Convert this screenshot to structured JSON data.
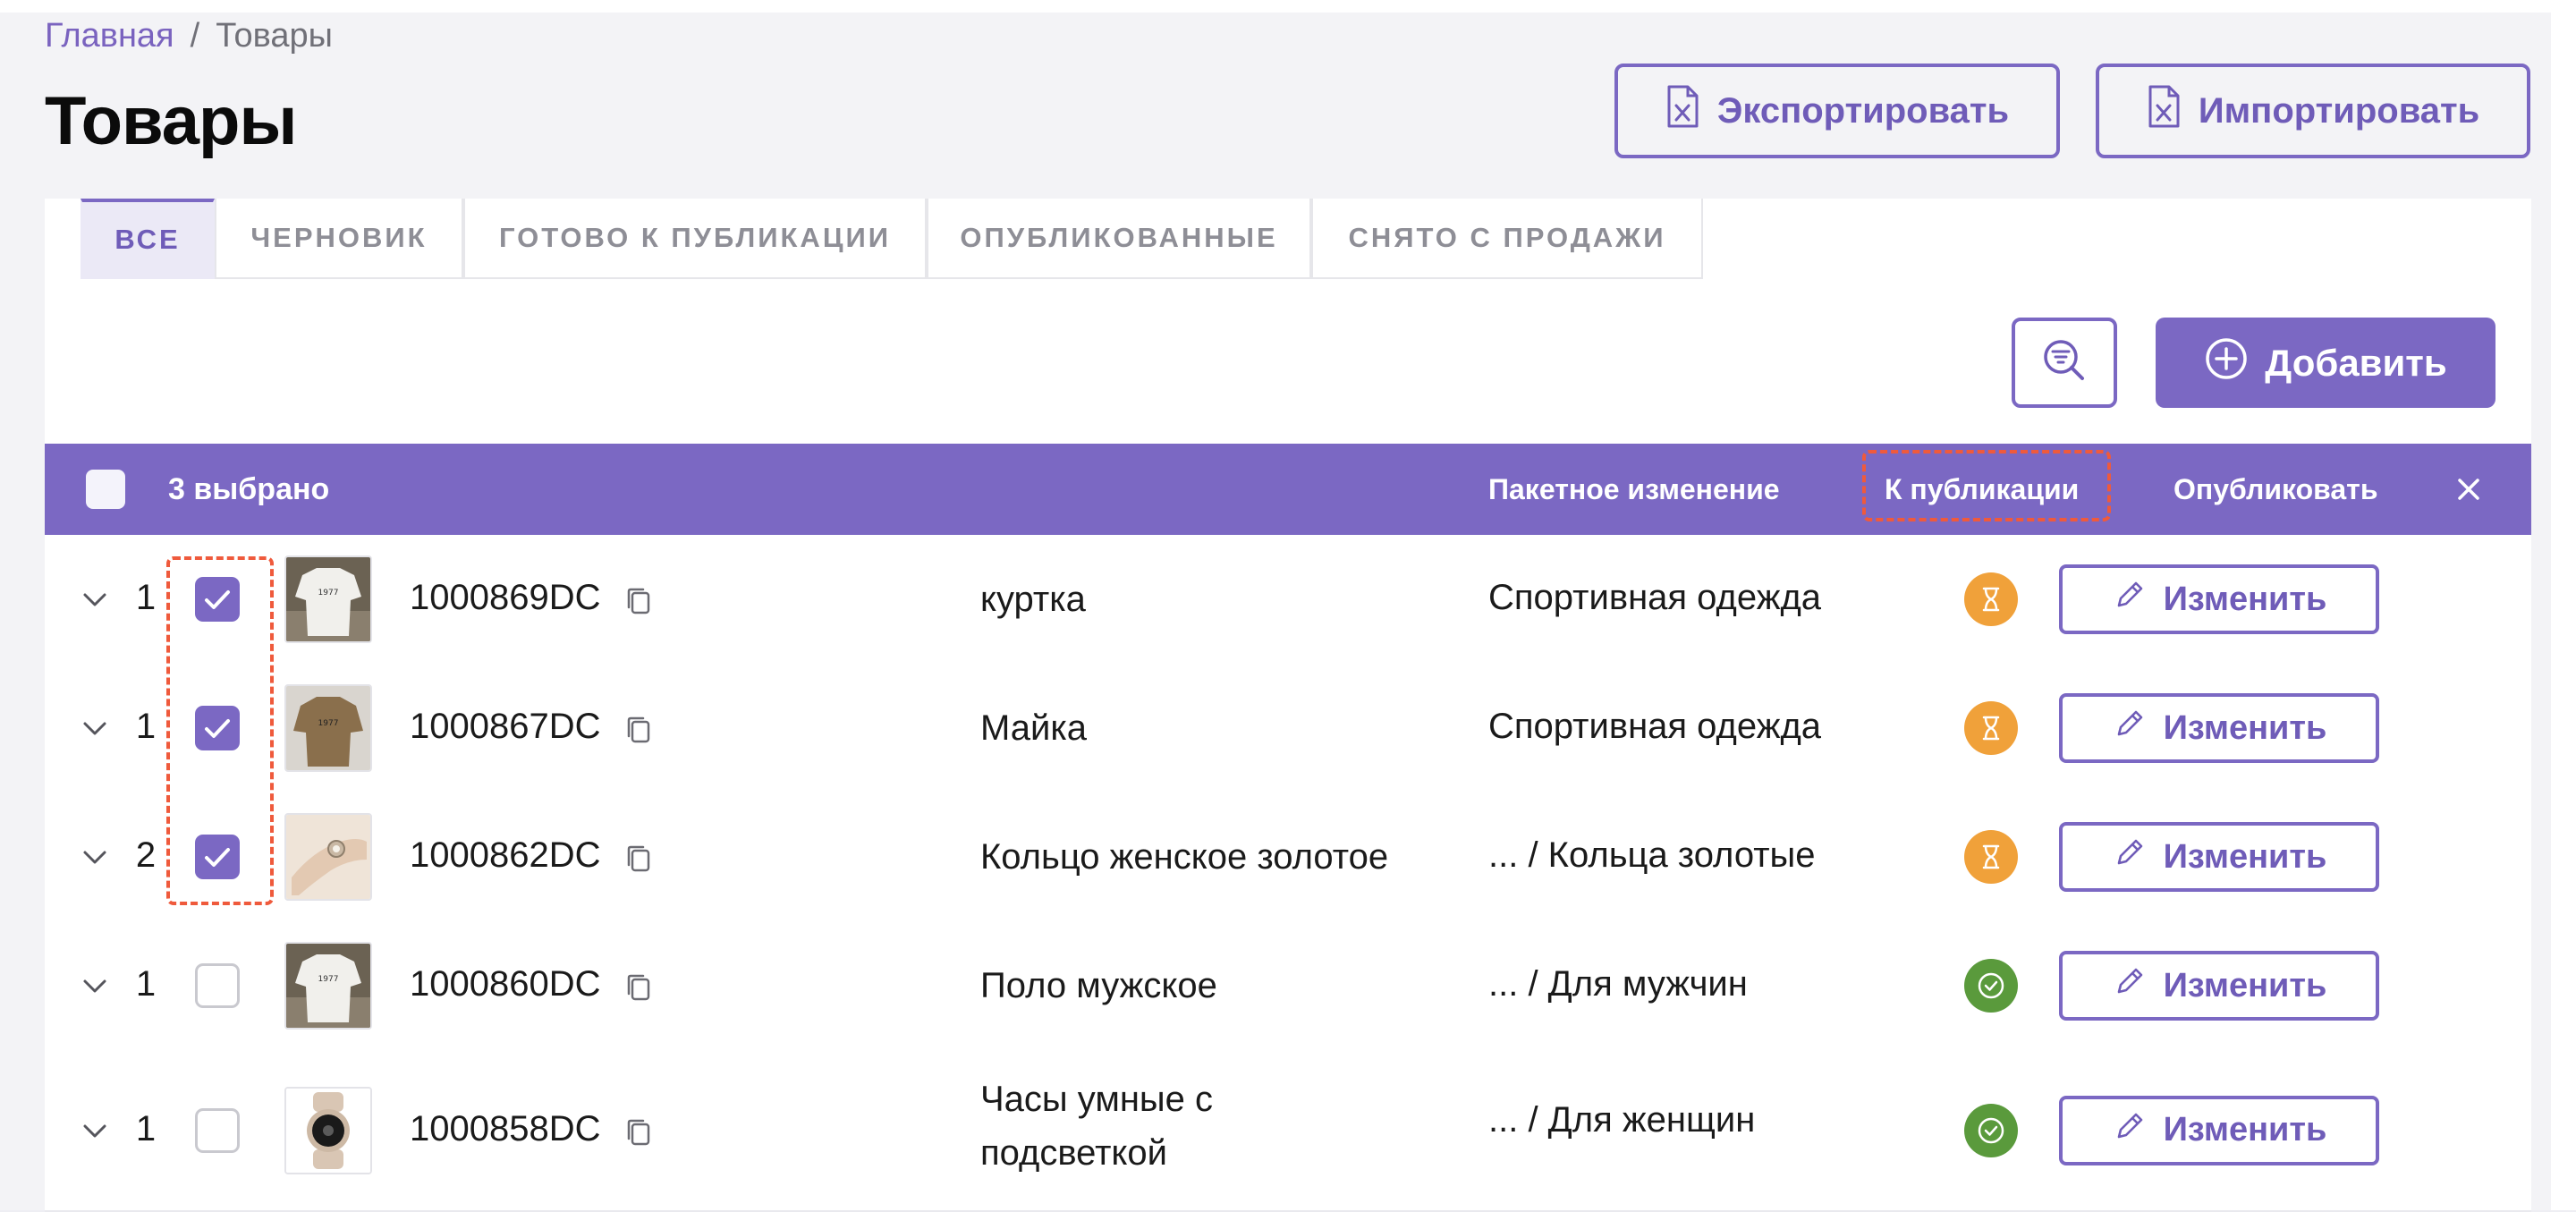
{
  "breadcrumb": {
    "home": "Главная",
    "separator": "/",
    "current": "Товары"
  },
  "page_title": "Товары",
  "header_actions": {
    "export_label": "Экспортировать",
    "import_label": "Импортировать"
  },
  "tabs": [
    {
      "label": "ВСЕ",
      "active": true
    },
    {
      "label": "ЧЕРНОВИК",
      "active": false
    },
    {
      "label": "ГОТОВО К ПУБЛИКАЦИИ",
      "active": false
    },
    {
      "label": "ОПУБЛИКОВАННЫЕ",
      "active": false
    },
    {
      "label": "СНЯТО С ПРОДАЖИ",
      "active": false
    }
  ],
  "toolbar": {
    "filter_icon": "filter-search-icon",
    "add_label": "Добавить"
  },
  "bulk_bar": {
    "selected_text": "3 выбрано",
    "batch_edit": "Пакетное изменение",
    "to_publication": "К публикации",
    "publish": "Опубликовать",
    "close_icon": "close-icon"
  },
  "products": [
    {
      "qty": "1",
      "checked": true,
      "sku": "1000869DC",
      "name": "куртка",
      "category": "Спортивная одежда",
      "status": "pending",
      "edit_label": "Изменить",
      "thumb": "white-tshirt"
    },
    {
      "qty": "1",
      "checked": true,
      "sku": "1000867DC",
      "name": "Майка",
      "category": "Спортивная одежда",
      "status": "pending",
      "edit_label": "Изменить",
      "thumb": "brown-tshirt"
    },
    {
      "qty": "2",
      "checked": true,
      "sku": "1000862DC",
      "name": "Кольцо женское золотое",
      "category": "... / Кольца золотые",
      "status": "pending",
      "edit_label": "Изменить",
      "thumb": "ring-hand"
    },
    {
      "qty": "1",
      "checked": false,
      "sku": "1000860DC",
      "name": "Поло мужское",
      "category": "... / Для мужчин",
      "status": "done",
      "edit_label": "Изменить",
      "thumb": "white-tshirt"
    },
    {
      "qty": "1",
      "checked": false,
      "sku": "1000858DC",
      "name": "Часы умные с подсветкой",
      "category": "... / Для женщин",
      "status": "done",
      "edit_label": "Изменить",
      "thumb": "smartwatch"
    }
  ],
  "colors": {
    "accent": "#7b68c3",
    "pending": "#f0a13a",
    "done": "#5a9a3c",
    "highlight": "#ef5a3c"
  }
}
